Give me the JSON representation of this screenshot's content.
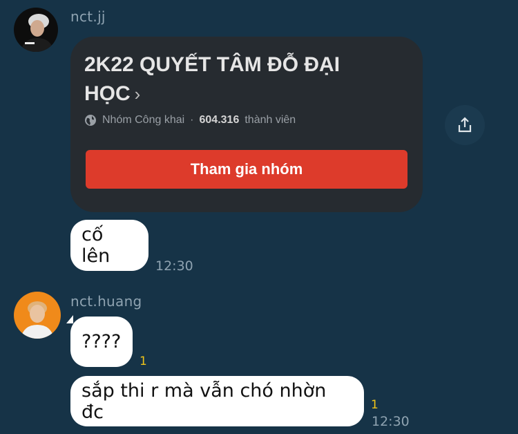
{
  "messages": {
    "first": {
      "sender": "nct.jj",
      "group_card": {
        "title": "2K22 QUYẾT TÂM ĐỖ ĐẠI HỌC",
        "chevron": "›",
        "privacy": "Nhóm Công khai",
        "separator": "·",
        "members_count": "604.316",
        "members_label": "thành viên",
        "join_label": "Tham gia nhóm",
        "icon": "globe-icon"
      },
      "share_icon": "share-icon",
      "text": "cố lên",
      "time": "12:30"
    },
    "second": {
      "sender": "nct.huang",
      "bubble1": "????",
      "bubble1_read": "1",
      "bubble2": "sắp thi r mà vẫn chó nhờn đc",
      "bubble2_read": "1",
      "time": "12:30"
    }
  },
  "colors": {
    "background": "#163347",
    "card": "#262b30",
    "join_button": "#dd3b2b",
    "read_indicator": "#f0c419"
  }
}
